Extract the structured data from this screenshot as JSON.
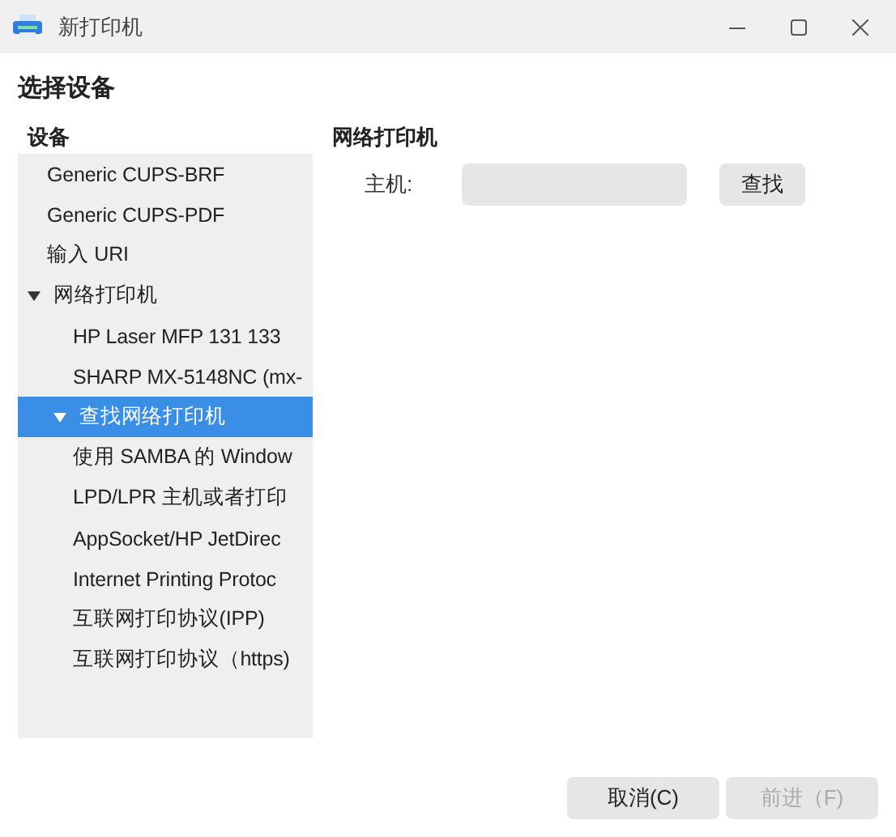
{
  "window": {
    "title": "新打印机"
  },
  "heading": "选择设备",
  "device_list": {
    "header": "设备",
    "items": [
      {
        "label": "Generic CUPS-BRF",
        "selected": false
      },
      {
        "label": "Generic CUPS-PDF",
        "selected": false
      },
      {
        "label": "输入 URI",
        "selected": false
      },
      {
        "label": "网络打印机",
        "selected": false,
        "expanded": true,
        "children": [
          {
            "label": "HP Laser MFP 131 133",
            "selected": false
          },
          {
            "label": "SHARP MX-5148NC (mx-",
            "selected": false
          },
          {
            "label": "查找网络打印机",
            "selected": true,
            "expanded": true,
            "children": [
              {
                "label": "使用 SAMBA 的 Window",
                "selected": false
              },
              {
                "label": "LPD/LPR 主机或者打印",
                "selected": false
              },
              {
                "label": "AppSocket/HP JetDirec",
                "selected": false
              },
              {
                "label": "Internet Printing Protoc",
                "selected": false
              },
              {
                "label": "互联网打印协议(IPP)",
                "selected": false
              },
              {
                "label": "互联网打印协议（https)",
                "selected": false
              }
            ]
          }
        ]
      }
    ]
  },
  "detail": {
    "title": "网络打印机",
    "host_label": "主机:",
    "find_button": "查找"
  },
  "buttons": [
    {
      "label": "取消(C)",
      "disabled": false
    },
    {
      "label": "前进（F)",
      "disabled": true
    }
  ]
}
